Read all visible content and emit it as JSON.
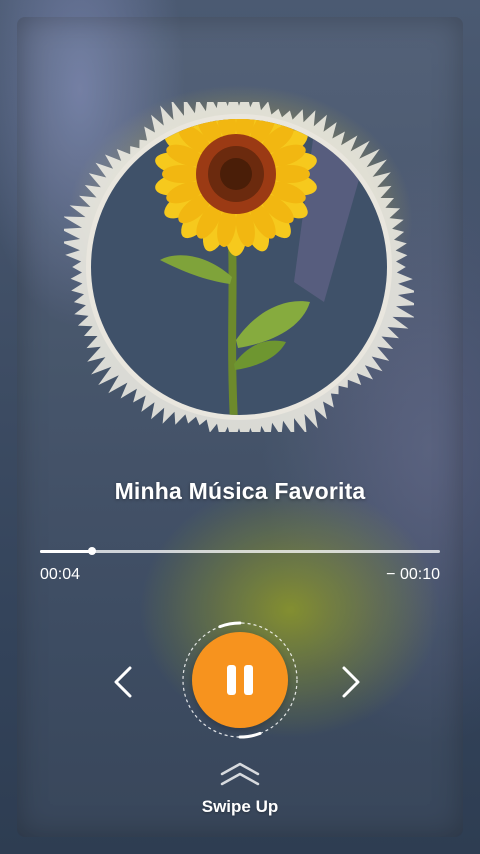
{
  "player": {
    "song_title": "Minha Música Favorita",
    "time_elapsed": "00:04",
    "time_remaining": "− 00:10",
    "progress": 0.13,
    "state": "playing"
  },
  "controls": {
    "previous_icon": "chevron-left-icon",
    "pause_icon": "pause-icon",
    "next_icon": "chevron-right-icon"
  },
  "swipe": {
    "icon": "double-chevron-up-icon",
    "label": "Swipe Up"
  },
  "colors": {
    "accent": "#f7931e",
    "text": "#ffffff",
    "art_background": "#3f5169",
    "sunflower_petals": "#f6c91d"
  }
}
